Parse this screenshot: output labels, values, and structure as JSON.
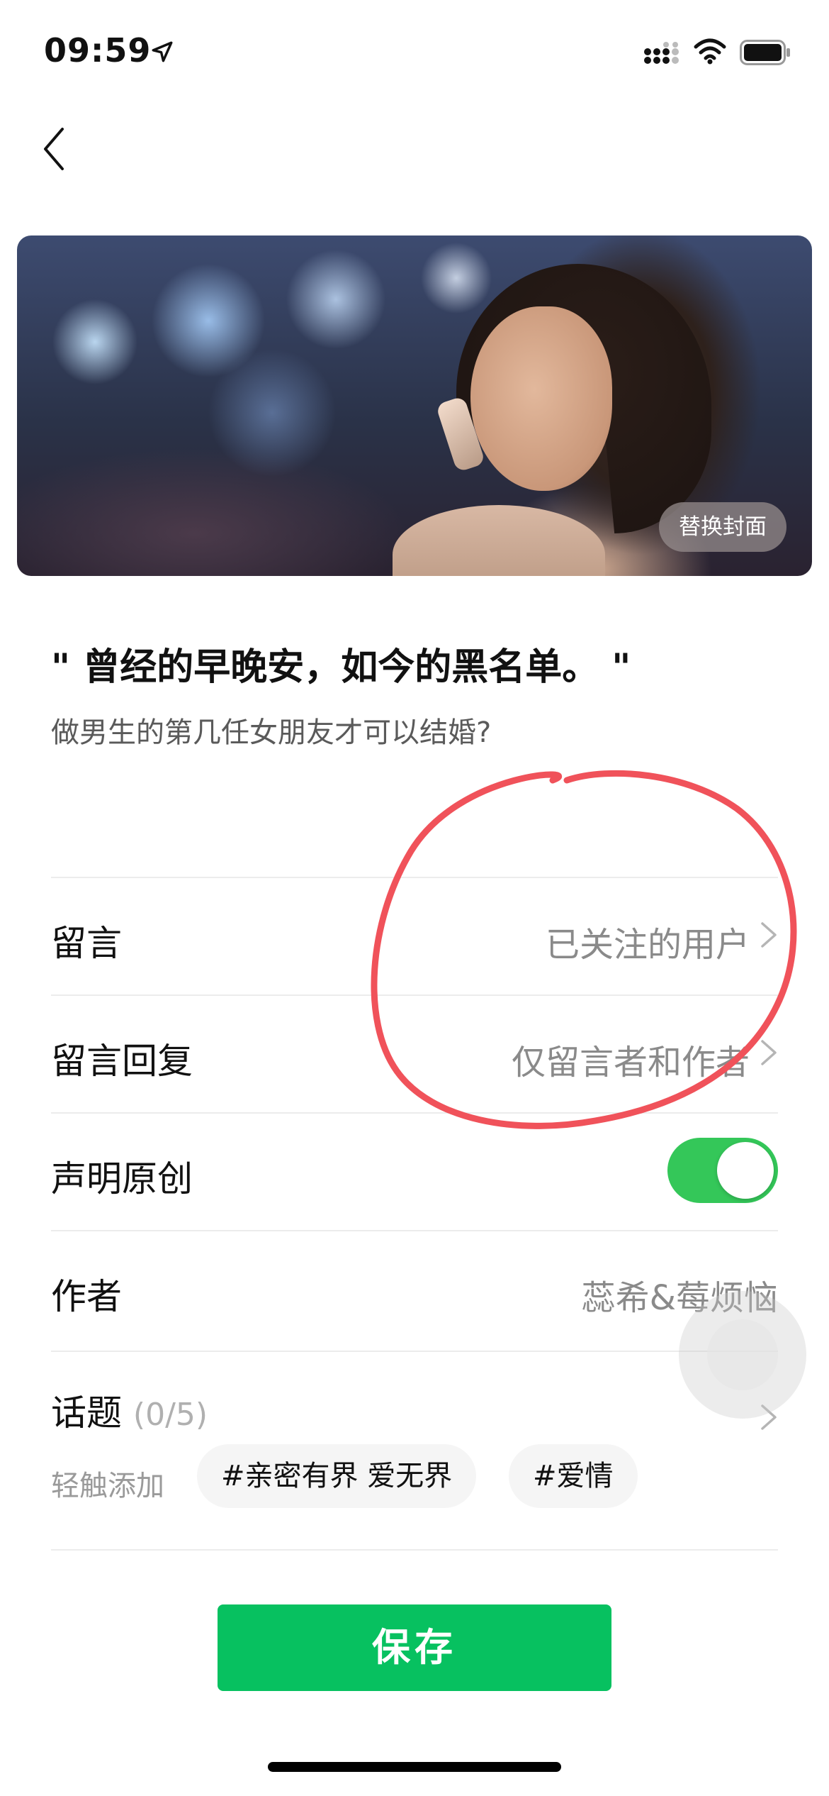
{
  "status_bar": {
    "time": "09:59",
    "icons": [
      "location-arrow-icon",
      "cellular-signal-icon",
      "wifi-icon",
      "battery-icon"
    ]
  },
  "nav": {
    "back_icon": "chevron-left-icon"
  },
  "cover": {
    "replace_label": "替换封面"
  },
  "article": {
    "title": "\" 曾经的早晚安，如今的黑名单。 \"",
    "subtitle": "做男生的第几任女朋友才可以结婚?"
  },
  "settings": {
    "comments": {
      "label": "留言",
      "value": "已关注的用户"
    },
    "comment_reply": {
      "label": "留言回复",
      "value": "仅留言者和作者"
    },
    "original": {
      "label": "声明原创",
      "toggle_on": true
    },
    "author": {
      "label": "作者",
      "value": "蕊希&莓烦恼"
    },
    "topics": {
      "label": "话题",
      "count": "(0/5)",
      "hint": "轻触添加",
      "tags": [
        "#亲密有界 爱无界",
        "#爱情"
      ]
    }
  },
  "actions": {
    "save_label": "保存"
  },
  "colors": {
    "accent_green": "#07c160",
    "toggle_green": "#34c759",
    "annotation_red": "#f0525a"
  }
}
